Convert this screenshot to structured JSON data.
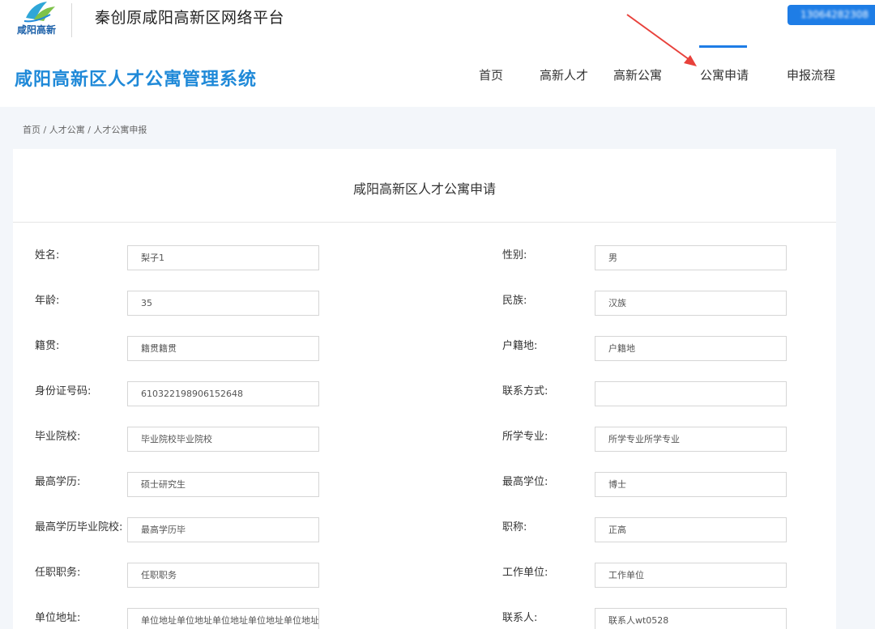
{
  "topbar": {
    "logo_text": "咸阳高新",
    "platform_title": "秦创原咸阳高新区网络平台",
    "user_id": "13064282308"
  },
  "header": {
    "system_title": "咸阳高新区人才公寓管理系统",
    "nav": [
      "首页",
      "高新人才",
      "高新公寓",
      "公寓申请",
      "申报流程"
    ],
    "active_nav": "公寓申请"
  },
  "breadcrumb": "首页 / 人才公寓 / 人才公寓申报",
  "form": {
    "title": "咸阳高新区人才公寓申请",
    "rows": [
      {
        "left": {
          "label": "姓名:",
          "value": "梨子1"
        },
        "right": {
          "label": "性别:",
          "value": "男"
        }
      },
      {
        "left": {
          "label": "年龄:",
          "value": "35"
        },
        "right": {
          "label": "民族:",
          "value": "汉族"
        }
      },
      {
        "left": {
          "label": "籍贯:",
          "value": "籍贯籍贯"
        },
        "right": {
          "label": "户籍地:",
          "value": "户籍地"
        }
      },
      {
        "left": {
          "label": "身份证号码:",
          "value": "610322198906152648"
        },
        "right": {
          "label": "联系方式:",
          "value": ""
        }
      },
      {
        "left": {
          "label": "毕业院校:",
          "value": "毕业院校毕业院校"
        },
        "right": {
          "label": "所学专业:",
          "value": "所学专业所学专业"
        }
      },
      {
        "left": {
          "label": "最高学历:",
          "value": "硕士研究生"
        },
        "right": {
          "label": "最高学位:",
          "value": "博士"
        }
      },
      {
        "left": {
          "label": "最高学历毕业院校:",
          "value": "最高学历毕"
        },
        "right": {
          "label": "职称:",
          "value": "正高"
        }
      },
      {
        "left": {
          "label": "任职职务:",
          "value": "任职职务"
        },
        "right": {
          "label": "工作单位:",
          "value": "工作单位"
        }
      },
      {
        "left": {
          "label": "单位地址:",
          "value": "单位地址单位地址单位地址单位地址单位地址"
        },
        "right": {
          "label": "联系人:",
          "value": "联系人wt0528"
        }
      }
    ]
  },
  "colors": {
    "accent": "#1e7de6",
    "title_blue": "#1f89d8",
    "annotation_arrow": "#e8413b"
  }
}
